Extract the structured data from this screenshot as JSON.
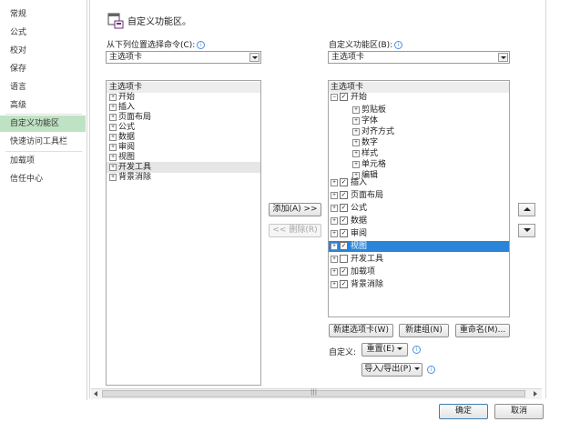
{
  "nav": {
    "items": [
      "常规",
      "公式",
      "校对",
      "保存",
      "语言",
      "高级",
      "自定义功能区",
      "快速访问工具栏",
      "加载项",
      "信任中心"
    ],
    "selected": "自定义功能区"
  },
  "header": {
    "title": "自定义功能区。"
  },
  "left": {
    "label": "从下列位置选择命令(C):",
    "combo_value": "主选项卡",
    "list": [
      "主选项卡",
      "开始",
      "插入",
      "页面布局",
      "公式",
      "数据",
      "审阅",
      "视图",
      "开发工具",
      "背景消除"
    ]
  },
  "middle": {
    "add": "添加(A) >>",
    "remove": "<< 删除(R)"
  },
  "right": {
    "label": "自定义功能区(B):",
    "combo_value": "主选项卡",
    "list_header": "主选项卡",
    "start_tab": "开始",
    "start_groups": [
      "剪贴板",
      "字体",
      "对齐方式",
      "数字",
      "样式",
      "单元格",
      "编辑"
    ],
    "tabs": [
      {
        "label": "插入",
        "checked": true
      },
      {
        "label": "页面布局",
        "checked": true
      },
      {
        "label": "公式",
        "checked": true
      },
      {
        "label": "数据",
        "checked": true
      },
      {
        "label": "审阅",
        "checked": true
      },
      {
        "label": "视图",
        "checked": true
      },
      {
        "label": "开发工具",
        "checked": false
      },
      {
        "label": "加载项",
        "checked": true
      },
      {
        "label": "背景消除",
        "checked": true
      }
    ],
    "selected_tab": "视图"
  },
  "bottom_buttons": {
    "new_tab": "新建选项卡(W)",
    "new_group": "新建组(N)",
    "rename": "重命名(M)..."
  },
  "customize": {
    "label": "自定义:",
    "reset": "重置(E)",
    "import_export": "导入/导出(P)"
  },
  "scrollbar": {
    "grip": "|||"
  },
  "footer": {
    "ok": "确定",
    "cancel": "取消"
  },
  "colors": {
    "nav_selected": "#bfe2c4",
    "list_selected": "#2a84d8"
  }
}
